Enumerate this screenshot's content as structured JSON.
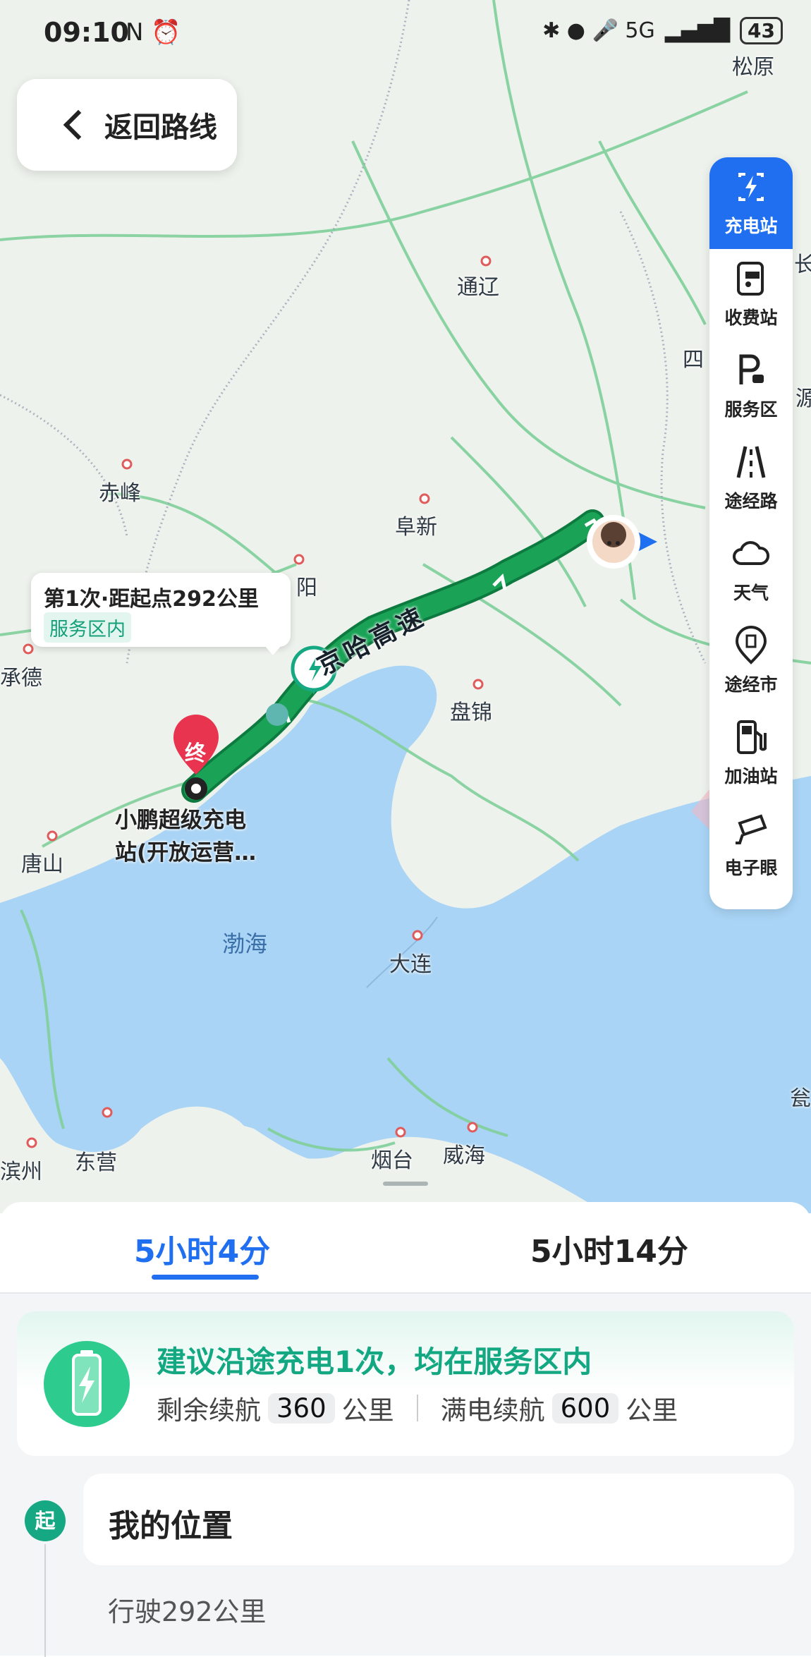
{
  "status_bar": {
    "time": "09:10",
    "left_icons": "N ⏰",
    "icons": "✱ ● 🎤 5G",
    "battery": "43"
  },
  "back_button": {
    "label": "返回路线"
  },
  "toolbar": [
    {
      "label": "充电站",
      "icon": "charging-station-icon",
      "active": true
    },
    {
      "label": "收费站",
      "icon": "toll-station-icon"
    },
    {
      "label": "服务区",
      "icon": "service-area-icon"
    },
    {
      "label": "途经路",
      "icon": "road-icon"
    },
    {
      "label": "天气",
      "icon": "cloud-icon"
    },
    {
      "label": "途经市",
      "icon": "city-pin-icon"
    },
    {
      "label": "加油站",
      "icon": "fuel-pump-icon"
    },
    {
      "label": "电子眼",
      "icon": "camera-icon"
    }
  ],
  "map": {
    "cities": [
      "松原",
      "通辽",
      "四",
      "赤峰",
      "阜新",
      "阳",
      "承德",
      "盘锦",
      "唐山",
      "大连",
      "烟台",
      "威海",
      "东营",
      "滨州",
      "长",
      "源",
      "瓮"
    ],
    "sea": "渤海",
    "road_name": "京哈高速",
    "destination_marker": "终",
    "destination_name_line1": "小鹏超级充电",
    "destination_name_line2": "站(开放运营…",
    "route_color": "#1aa356",
    "water_color": "#a9d4f5"
  },
  "popup": {
    "title": "第1次·距起点292公里",
    "tag": "服务区内"
  },
  "route_tabs": [
    {
      "label": "5小时4分",
      "active": true
    },
    {
      "label": "5小时14分",
      "active": false
    }
  ],
  "charging": {
    "headline": "建议沿途充电1次，均在服务区内",
    "remaining_label": "剩余续航",
    "remaining_value": "360",
    "full_label": "满电续航",
    "full_value": "600",
    "unit": "公里"
  },
  "steps": {
    "start_badge": "起",
    "start_title": "我的位置",
    "drive_text": "行驶292公里"
  }
}
